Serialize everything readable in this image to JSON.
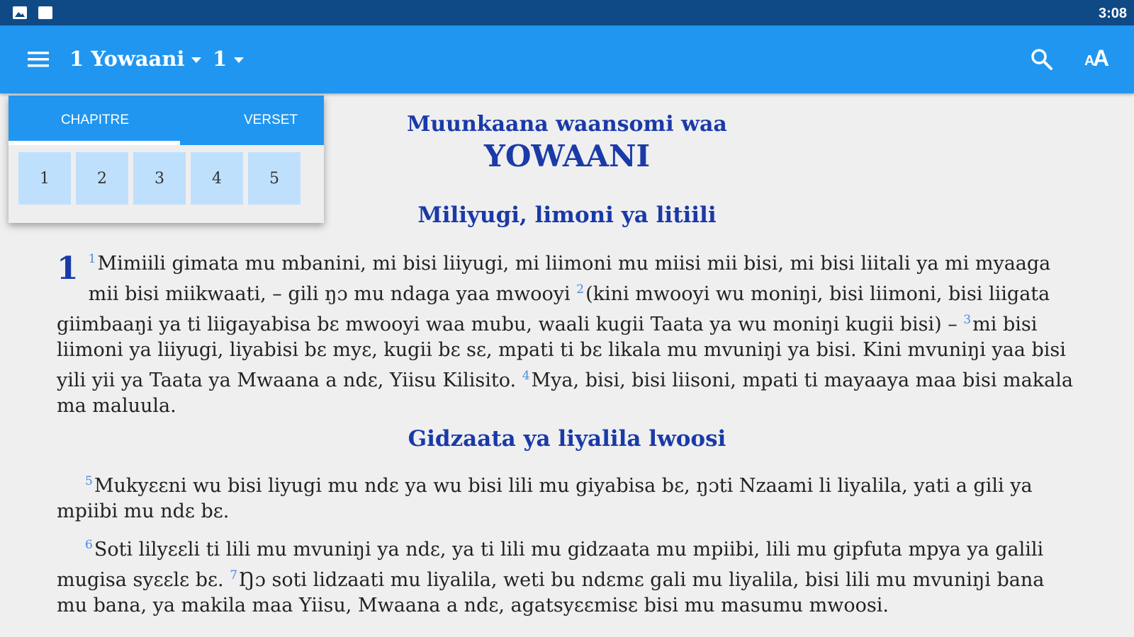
{
  "status_bar": {
    "time": "3:08",
    "icons": [
      "image-icon",
      "message-icon"
    ]
  },
  "app_bar": {
    "book": "1 Yowaani",
    "chapter": "1",
    "icons": [
      "menu-icon",
      "search-icon",
      "text-size-icon"
    ],
    "text_size_small": "A",
    "text_size_big": "A"
  },
  "picker": {
    "tab_chapter": "CHAPITRE",
    "tab_verse": "VERSET",
    "numbers": [
      "1",
      "2",
      "3",
      "4",
      "5"
    ]
  },
  "content": {
    "subtitle": "Muunkaana waansomi waa",
    "title": "YOWAANI",
    "section1": "Miliyugi, limoni ya litiili",
    "chapter_number": "1",
    "v1_num": "1",
    "v1": "Mimiili gimata mu mbanini, mi bisi liiyugi, mi liimoni mu miisi mii bisi, mi bisi liitali ya mi myaaga mii bisi miikwaati, – gili ŋɔ mu ndaga yaa mwooyi",
    "v2_num": "2",
    "v2": "(kini mwooyi wu moniŋi, bisi liimoni, bisi liigata giimbaaŋi ya ti liigayabisa bɛ mwooyi waa mubu, waali kugii Taata ya wu moniŋi kugii bisi) –",
    "v3_num": "3",
    "v3": "mi bisi liimoni ya liiyugi, liyabisi bɛ myɛ, kugii bɛ sɛ, mpati ti bɛ likala mu mvuniŋi ya bisi. Kini mvuniŋi yaa bisi yili yii ya Taata ya Mwaana a ndɛ, Yiisu Kilisito.",
    "v4_num": "4",
    "v4": "Mya, bisi, bisi liisoni, mpati ti mayaaya maa bisi makala ma maluula.",
    "section2": "Gidzaata ya liyalila lwoosi",
    "v5_num": "5",
    "v5": "Mukyɛɛni wu bisi liyugi mu ndɛ ya wu bisi lili mu giyabisa bɛ, ŋɔti Nzaami li liyalila, yati a gili ya mpiibi mu ndɛ bɛ.",
    "v6_num": "6",
    "v6": "Soti lilyɛɛli ti lili mu mvuniŋi ya ndɛ, ya ti lili mu gidzaata mu mpiibi, lili mu gipfuta mpya ya galili mugisa syɛɛlɛ bɛ.",
    "v7_num": "7",
    "v7": "Ŋɔ soti lidzaati mu liyalila, weti bu ndɛmɛ gali mu liyalila, bisi lili mu mvuniŋi bana mu bana, ya makila maa Yiisu, Mwaana a ndɛ, agatsyɛɛmisɛ bisi mu masumu mwoosi."
  },
  "colors": {
    "status_bar": "#0f4a86",
    "app_bar": "#2196f0",
    "heading": "#1a3aa8",
    "verse_number": "#4a8ae0",
    "picker_cell": "#bfe0fc"
  }
}
